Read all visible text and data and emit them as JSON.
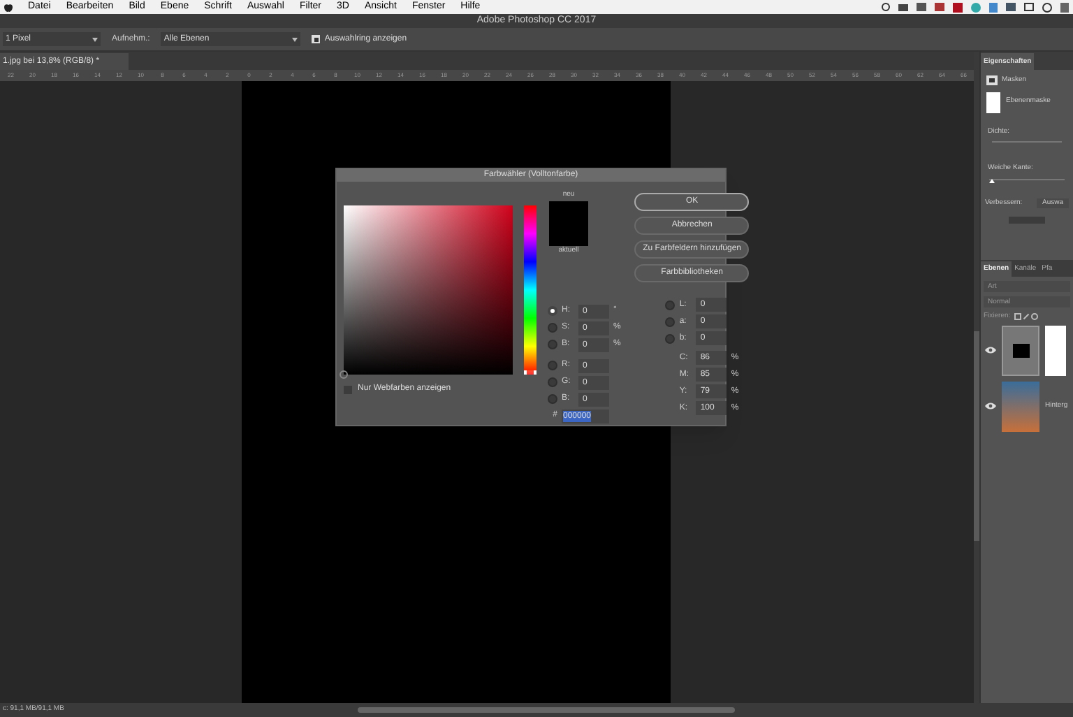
{
  "menu_bar": {
    "items": [
      "Datei",
      "Bearbeiten",
      "Bild",
      "Ebene",
      "Schrift",
      "Auswahl",
      "Filter",
      "3D",
      "Ansicht",
      "Fenster",
      "Hilfe"
    ]
  },
  "window": {
    "title": "Adobe Photoshop CC 2017"
  },
  "options_bar": {
    "brush_size": "1 Pixel",
    "sample_label": "Aufnehm.:",
    "sample_value": "Alle Ebenen",
    "show_ring": {
      "label": "Auswahlring anzeigen",
      "checked": true
    }
  },
  "document_tab": {
    "title": "1.jpg bei 13,8% (RGB/8) *"
  },
  "ruler": {
    "ticks": [
      "22",
      "20",
      "18",
      "16",
      "14",
      "12",
      "10",
      "8",
      "6",
      "4",
      "2",
      "0",
      "2",
      "4",
      "6",
      "8",
      "10",
      "12",
      "14",
      "16",
      "18",
      "20",
      "22",
      "24",
      "26",
      "28",
      "30",
      "32",
      "34",
      "36",
      "38",
      "40",
      "42",
      "44",
      "46",
      "48",
      "50",
      "52",
      "54",
      "56",
      "58",
      "60",
      "62",
      "64",
      "66"
    ]
  },
  "color_picker": {
    "title": "Farbwähler (Volltonfarbe)",
    "new_label": "neu",
    "current_label": "aktuell",
    "web_colors": {
      "label": "Nur Webfarben anzeigen",
      "checked": false
    },
    "buttons": [
      "OK",
      "Abbrechen",
      "Zu Farbfeldern hinzufügen",
      "Farbbibliotheken"
    ],
    "left_fields": [
      {
        "label": "H:",
        "value": "0",
        "unit": "°",
        "selected": true
      },
      {
        "label": "S:",
        "value": "0",
        "unit": "%",
        "selected": false
      },
      {
        "label": "B:",
        "value": "0",
        "unit": "%",
        "selected": false
      },
      {
        "label": "R:",
        "value": "0",
        "selected": false
      },
      {
        "label": "G:",
        "value": "0",
        "selected": false
      },
      {
        "label": "B:",
        "value": "0",
        "selected": false
      }
    ],
    "lab_fields": [
      {
        "label": "L:",
        "value": "0",
        "selected": false
      },
      {
        "label": "a:",
        "value": "0",
        "selected": false
      },
      {
        "label": "b:",
        "value": "0",
        "selected": false
      }
    ],
    "cmyk_fields": [
      {
        "label": "C:",
        "value": "86",
        "unit": "%"
      },
      {
        "label": "M:",
        "value": "85",
        "unit": "%"
      },
      {
        "label": "Y:",
        "value": "79",
        "unit": "%"
      },
      {
        "label": "K:",
        "value": "100",
        "unit": "%"
      }
    ],
    "hex": {
      "label": "#",
      "value": "000000"
    },
    "hue": {
      "level": 0
    }
  },
  "properties_panel": {
    "tab": "Eigenschaften",
    "masks_label": "Masken",
    "mask_name": "Ebenenmaske",
    "density_label": "Dichte:",
    "feather_label": "Weiche Kante:",
    "feather": {
      "level": 0
    },
    "refine_label": "Verbessern:",
    "refine_button": "Auswa"
  },
  "layers_panel": {
    "tabs": [
      {
        "label": "Ebenen",
        "selected": true
      },
      {
        "label": "Kanäle",
        "selected": false
      },
      {
        "label": "Pfa",
        "selected": false
      }
    ],
    "search_placeholder": "Art",
    "blend_mode": "Normal",
    "lock_label": "Fixieren:",
    "layers": [
      {
        "kind": "mask",
        "visible": true
      },
      {
        "kind": "photo",
        "name": "Hinterg",
        "visible": true
      }
    ]
  },
  "status_bar": {
    "doc_size": "c: 91,1 MB/91,1 MB"
  }
}
